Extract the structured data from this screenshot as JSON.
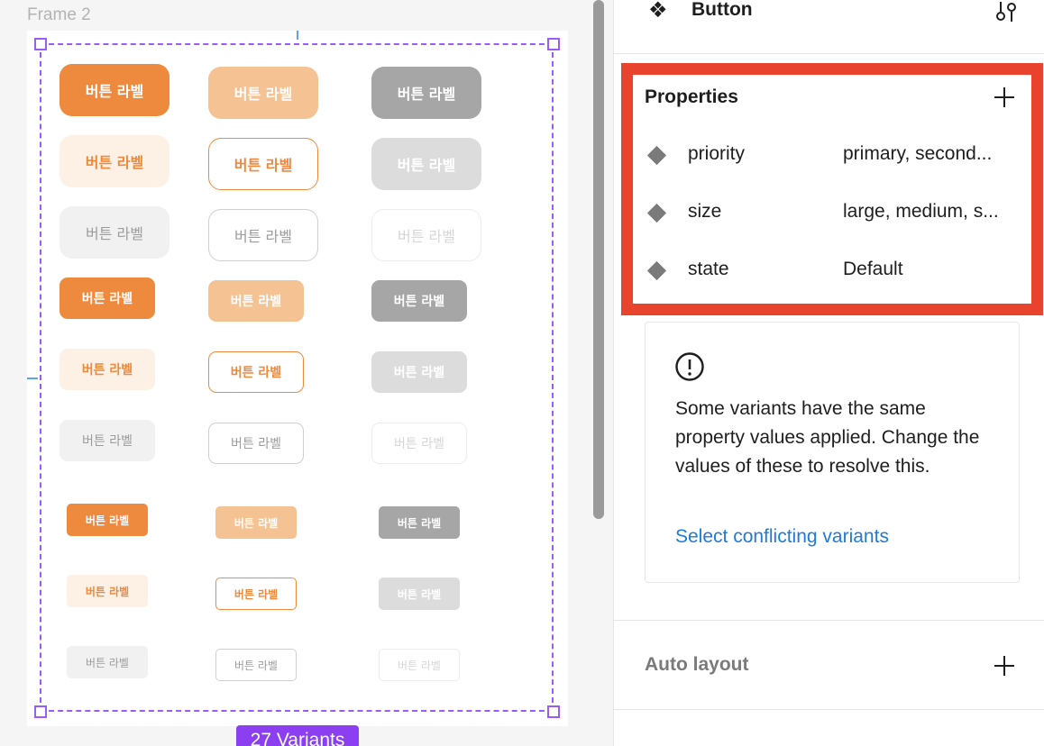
{
  "canvas": {
    "frame_label": "Frame 2",
    "variants_badge": "27 Variants",
    "selection_color": "#9b5cf5",
    "button_label": "버튼 라벨",
    "button_variants": [
      [
        [
          "primary-default",
          "primary-hover",
          "primary-disabled"
        ],
        [
          "secondary-default",
          "secondary-hover",
          "secondary-disabled"
        ],
        [
          "tertiary-default",
          "tertiary-hover",
          "tertiary-disabled"
        ]
      ],
      [
        [
          "primary-default",
          "primary-hover",
          "primary-disabled"
        ],
        [
          "secondary-default",
          "secondary-hover",
          "secondary-disabled"
        ],
        [
          "tertiary-default",
          "tertiary-hover",
          "tertiary-disabled"
        ]
      ],
      [
        [
          "primary-default",
          "primary-hover",
          "primary-disabled"
        ],
        [
          "secondary-default",
          "secondary-hover",
          "secondary-disabled"
        ],
        [
          "tertiary-default",
          "tertiary-hover",
          "tertiary-disabled"
        ]
      ]
    ],
    "colors": {
      "brand_orange": "#ed8a3d",
      "hover_orange": "#f5c293",
      "disabled_gray": "#a6a6a6"
    }
  },
  "panel": {
    "component_icon": "component-icon",
    "component_name": "Button",
    "properties": {
      "title": "Properties",
      "items": [
        {
          "name": "priority",
          "values": "primary, second..."
        },
        {
          "name": "size",
          "values": "large, medium, s..."
        },
        {
          "name": "state",
          "values": "Default"
        }
      ]
    },
    "warning": {
      "text": "Some variants have the same property values applied. Change the values of these to resolve this.",
      "link": "Select conflicting variants"
    },
    "auto_layout": {
      "title": "Auto layout"
    },
    "highlight_color": "#e8432c",
    "link_color": "#1f7ad9"
  }
}
